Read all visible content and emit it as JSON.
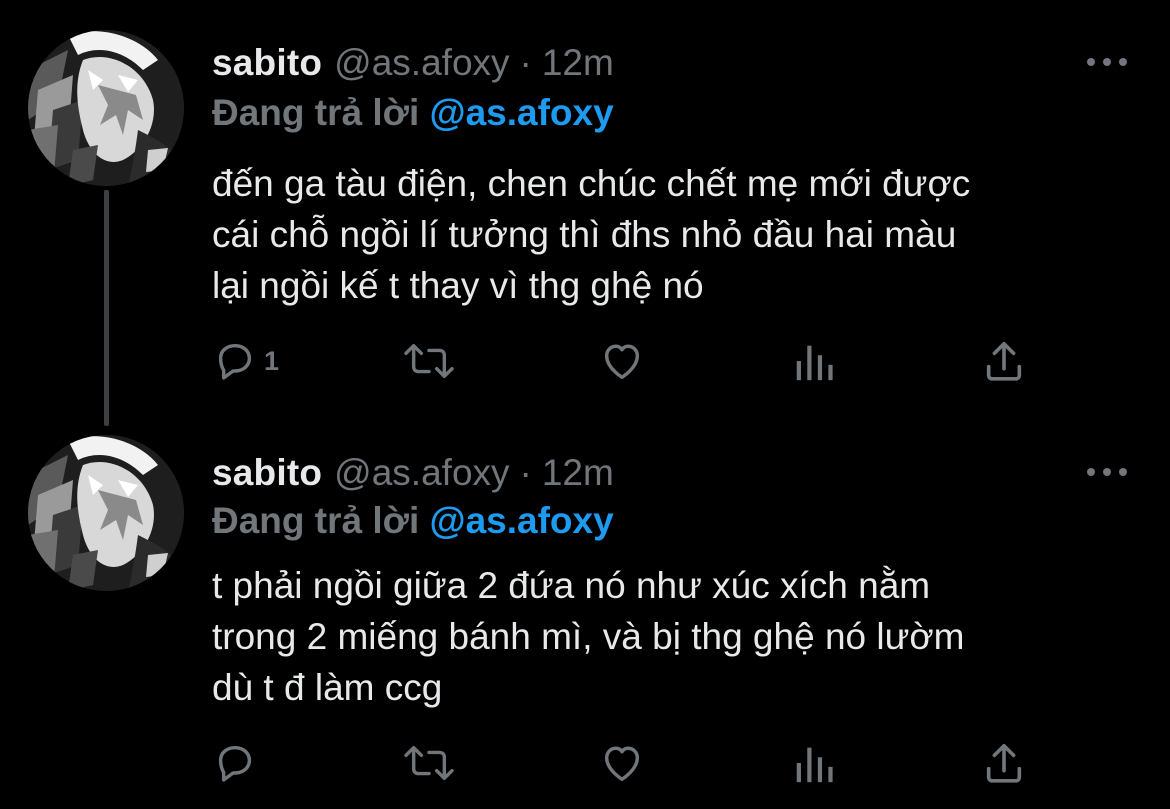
{
  "colors": {
    "background": "#000000",
    "text_primary": "#e7e9ea",
    "text_secondary": "#71767b",
    "mention": "#1d9bf0",
    "thread_line": "#3e4144"
  },
  "icons": {
    "reply": "speech-bubble-icon",
    "retweet": "retweet-arrows-icon",
    "like": "heart-outline-icon",
    "views": "bar-chart-icon",
    "share": "upload-arrow-icon",
    "more": "three-dots-icon"
  },
  "tweets": [
    {
      "name": "sabito",
      "handle": "@as.afoxy",
      "dot": "·",
      "time": "12m",
      "reply_prefix": "Đang trả lời",
      "reply_mention": "@as.afoxy",
      "lines": [
        "đến ga tàu điện, chen chúc chết mẹ mới được",
        "cái chỗ ngồi lí tưởng thì đhs nhỏ đầu hai màu",
        "lại ngồi kế t thay vì thg ghệ nó"
      ],
      "reply_count": "1"
    },
    {
      "name": "sabito",
      "handle": "@as.afoxy",
      "dot": "·",
      "time": "12m",
      "reply_prefix": "Đang trả lời",
      "reply_mention": "@as.afoxy",
      "lines": [
        "t phải ngồi giữa 2 đứa nó như xúc xích nằm",
        "trong 2 miếng bánh mì, và bị thg ghệ nó lườm",
        "dù t đ làm ccg"
      ],
      "reply_count": ""
    }
  ]
}
